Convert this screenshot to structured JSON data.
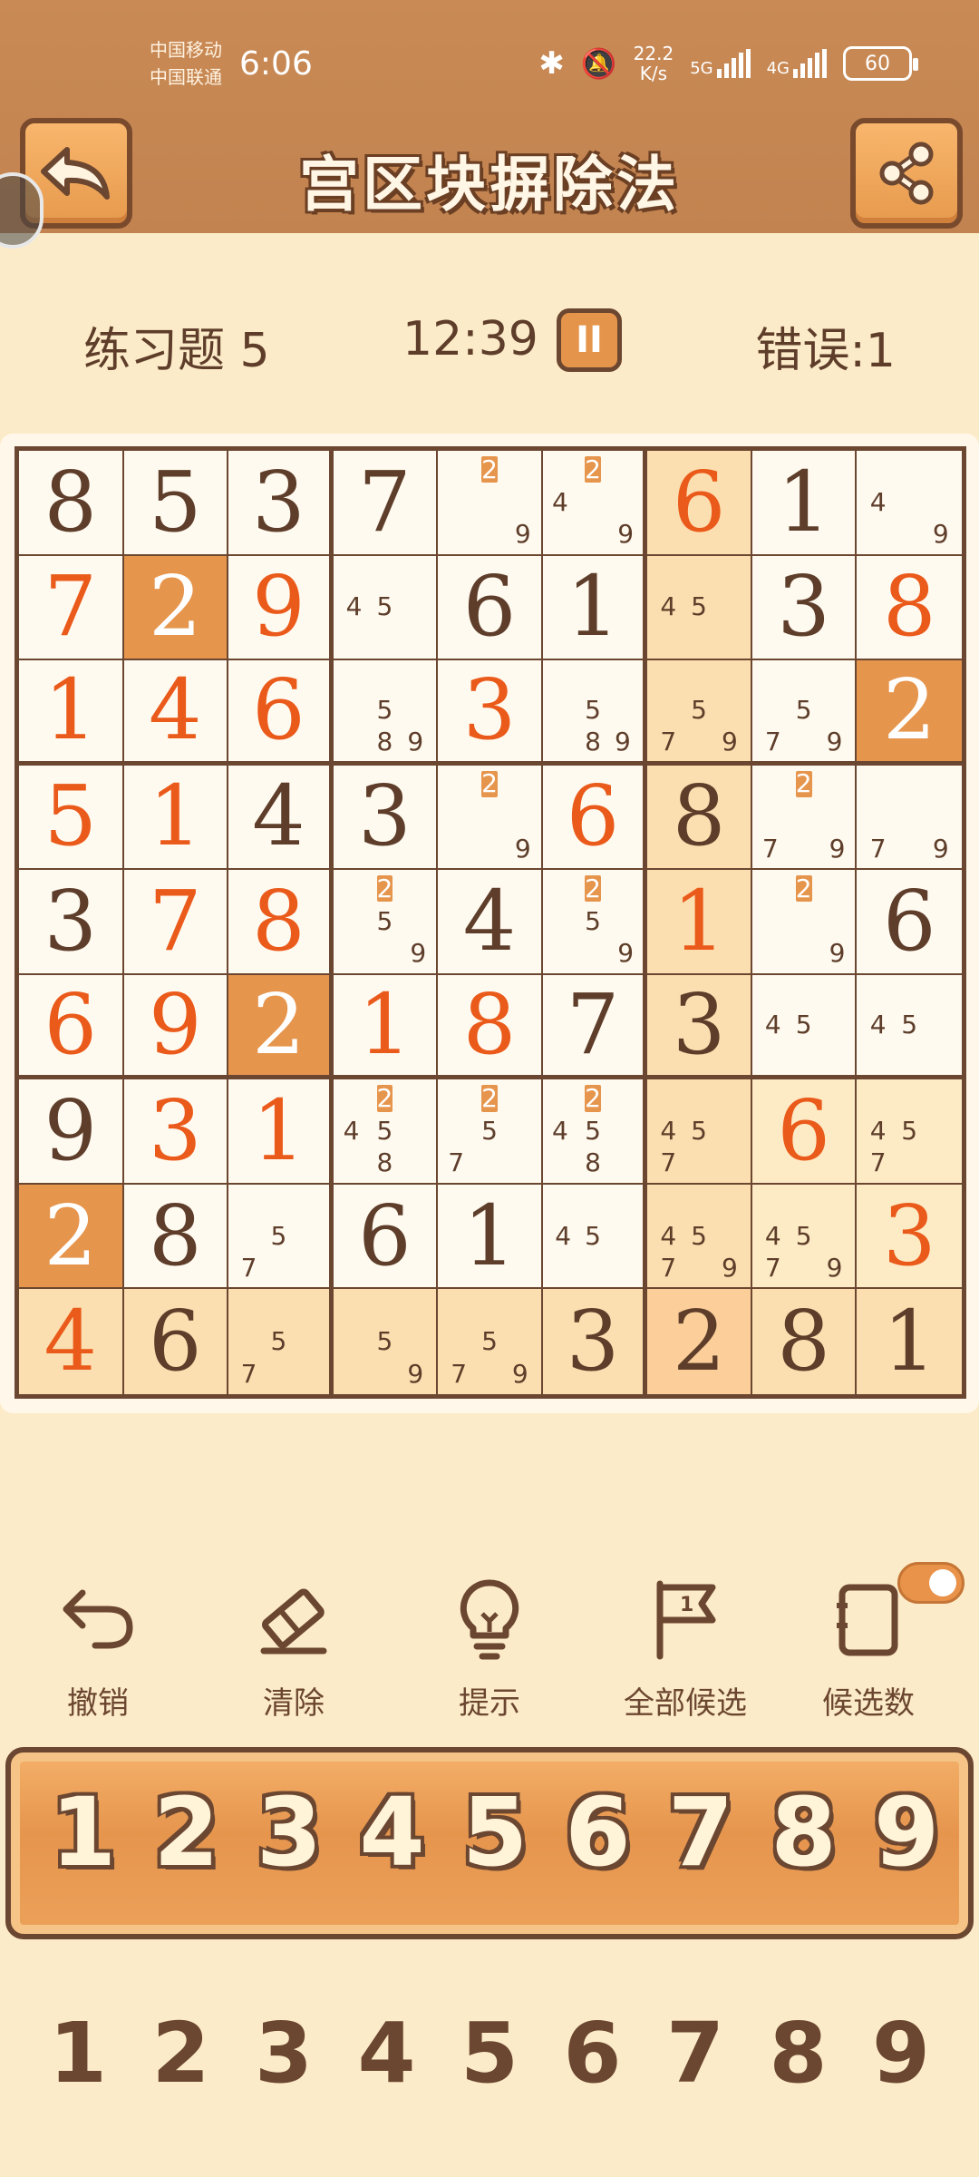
{
  "status_bar": {
    "carrier_1": "中国移动",
    "carrier_2": "中国联通",
    "time": "6:06",
    "net_speed_value": "22.2",
    "net_speed_unit": "K/s",
    "net_1": "5G",
    "net_2": "4G",
    "battery": "60"
  },
  "header": {
    "title": "宫区块摒除法",
    "back_icon": "back-arrow-icon",
    "share_icon": "share-icon"
  },
  "info": {
    "exercise": "练习题 5",
    "timer": "12:39",
    "pause_label": "II",
    "errors": "错误:1"
  },
  "board": {
    "rows": [
      [
        "8",
        "5",
        "3",
        "7",
        "",
        "",
        "6",
        "1",
        ""
      ],
      [
        "7",
        "2",
        "9",
        "",
        "6",
        "1",
        "",
        "3",
        "8"
      ],
      [
        "1",
        "4",
        "6",
        "",
        "3",
        "",
        "",
        "",
        "2"
      ],
      [
        "5",
        "1",
        "4",
        "3",
        "",
        "6",
        "8",
        "",
        ""
      ],
      [
        "3",
        "7",
        "8",
        "",
        "4",
        "",
        "1",
        "",
        "6"
      ],
      [
        "6",
        "9",
        "2",
        "1",
        "8",
        "7",
        "3",
        "",
        ""
      ],
      [
        "9",
        "3",
        "1",
        "",
        "",
        "",
        "",
        "6",
        ""
      ],
      [
        "2",
        "8",
        "",
        "6",
        "1",
        "",
        "",
        "",
        "3"
      ],
      [
        "4",
        "6",
        "",
        "",
        "",
        "3",
        "2",
        "8",
        "1"
      ]
    ],
    "user_entries": [
      [
        0,
        6
      ],
      [
        1,
        0
      ],
      [
        1,
        2
      ],
      [
        1,
        8
      ],
      [
        2,
        0
      ],
      [
        2,
        1
      ],
      [
        2,
        2
      ],
      [
        2,
        4
      ],
      [
        2,
        8
      ],
      [
        3,
        0
      ],
      [
        3,
        1
      ],
      [
        3,
        5
      ],
      [
        4,
        1
      ],
      [
        4,
        2
      ],
      [
        4,
        6
      ],
      [
        5,
        0
      ],
      [
        5,
        1
      ],
      [
        5,
        3
      ],
      [
        5,
        4
      ],
      [
        6,
        1
      ],
      [
        6,
        2
      ],
      [
        6,
        7
      ],
      [
        7,
        8
      ],
      [
        8,
        0
      ]
    ],
    "filled_cells": [
      [
        1,
        1
      ],
      [
        2,
        8
      ],
      [
        5,
        2
      ],
      [
        7,
        0
      ]
    ],
    "candidates": {
      "0,4": [
        "2",
        "9"
      ],
      "0,5": [
        "2",
        "4",
        "9"
      ],
      "0,8": [
        "4",
        "9"
      ],
      "1,3": [
        "4",
        "5"
      ],
      "1,6": [
        "4",
        "5"
      ],
      "2,3": [
        "5",
        "8",
        "9"
      ],
      "2,5": [
        "5",
        "8",
        "9"
      ],
      "2,6": [
        "5",
        "7",
        "9"
      ],
      "2,7": [
        "5",
        "7",
        "9"
      ],
      "3,4": [
        "2",
        "9"
      ],
      "3,7": [
        "2",
        "7",
        "9"
      ],
      "3,8": [
        "7",
        "9"
      ],
      "4,3": [
        "2",
        "5",
        "9"
      ],
      "4,5": [
        "2",
        "5",
        "9"
      ],
      "4,7": [
        "2",
        "9"
      ],
      "5,7": [
        "4",
        "5"
      ],
      "5,8": [
        "4",
        "5"
      ],
      "6,3": [
        "2",
        "4",
        "5",
        "8"
      ],
      "6,4": [
        "2",
        "5",
        "7"
      ],
      "6,5": [
        "2",
        "4",
        "5",
        "8"
      ],
      "6,6": [
        "4",
        "5",
        "7"
      ],
      "6,8": [
        "4",
        "5",
        "7"
      ],
      "7,2": [
        "5",
        "7"
      ],
      "7,5": [
        "4",
        "5"
      ],
      "7,6": [
        "4",
        "5",
        "7",
        "9"
      ],
      "7,7": [
        "4",
        "5",
        "7",
        "9"
      ],
      "8,2": [
        "5",
        "7"
      ],
      "8,3": [
        "5",
        "9"
      ],
      "8,4": [
        "5",
        "7",
        "9"
      ]
    },
    "highlighted_candidate": "2"
  },
  "tools": [
    {
      "label": "撤销",
      "icon": "undo-icon"
    },
    {
      "label": "清除",
      "icon": "eraser-icon"
    },
    {
      "label": "提示",
      "icon": "lightbulb-icon"
    },
    {
      "label": "全部候选",
      "icon": "flag-icon"
    },
    {
      "label": "候选数",
      "icon": "notebook-icon",
      "toggle_on": true
    }
  ],
  "number_pad": [
    "1",
    "2",
    "3",
    "4",
    "5",
    "6",
    "7",
    "8",
    "9"
  ],
  "pencil_pad": [
    "1",
    "2",
    "3",
    "4",
    "5",
    "6",
    "7",
    "8",
    "9"
  ]
}
